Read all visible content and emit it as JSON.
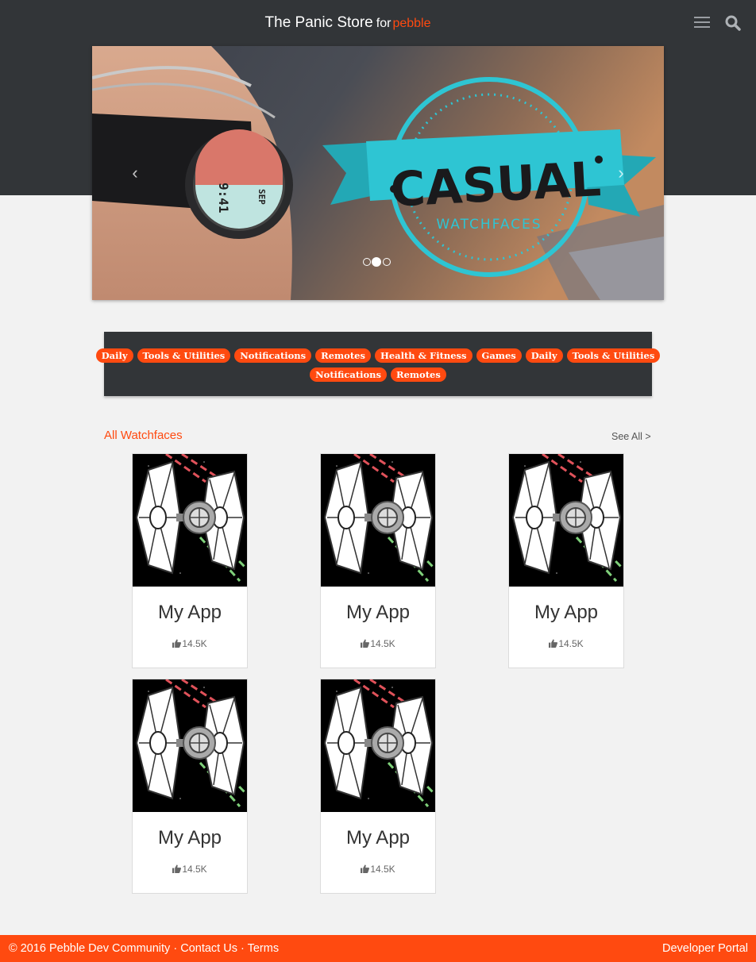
{
  "header": {
    "title": "The Panic Store",
    "for_label": "for",
    "brand": "pebble"
  },
  "carousel": {
    "badge_title": "CASUAL",
    "badge_subtitle": "WATCHFACES",
    "watch_time": "9:41",
    "watch_date": "SEP",
    "prev_arrow": "‹",
    "next_arrow": "›",
    "slide_count": 3,
    "active_slide": 2
  },
  "categories": {
    "row1": [
      "Daily",
      "Tools & Utilities",
      "Notifications",
      "Remotes",
      "Health & Fitness",
      "Games",
      "Daily",
      "Tools & Utilities"
    ],
    "row2": [
      "Notifications",
      "Remotes"
    ]
  },
  "section": {
    "title": "All Watchfaces",
    "see_all": "See All >"
  },
  "apps": [
    {
      "name": "My App",
      "likes": "14.5K"
    },
    {
      "name": "My App",
      "likes": "14.5K"
    },
    {
      "name": "My App",
      "likes": "14.5K"
    },
    {
      "name": "My App",
      "likes": "14.5K"
    },
    {
      "name": "My App",
      "likes": "14.5K"
    }
  ],
  "footer": {
    "copyright": "© 2016 Pebble Dev Community",
    "sep1": "·",
    "contact": "Contact Us",
    "sep2": "·",
    "terms": "Terms",
    "developer_portal": "Developer Portal"
  },
  "colors": {
    "accent": "#ff4a10",
    "header_bg": "#323538",
    "badge_teal": "#2ec5d3"
  },
  "icons": {
    "menu": "hamburger-menu-icon",
    "search": "search-icon",
    "like": "thumbs-up-icon"
  }
}
